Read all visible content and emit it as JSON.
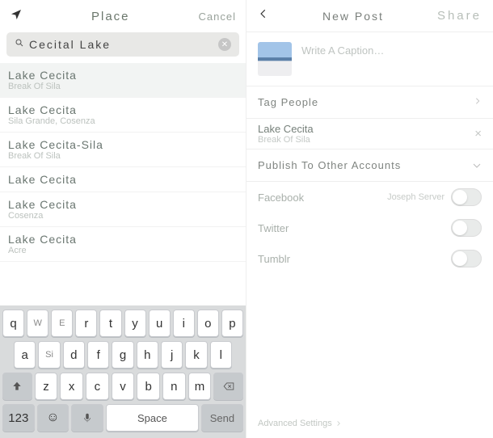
{
  "left": {
    "title": "Place",
    "cancel": "Cancel",
    "search": {
      "value": "Cecital Lake"
    },
    "places": [
      {
        "name": "Lake Cecita",
        "sub": "Break Of Sila",
        "selected": true
      },
      {
        "name": "Lake Cecita",
        "sub": "Sila Grande, Cosenza"
      },
      {
        "name": "Lake Cecita-Sila",
        "sub": "Break Of Sila"
      },
      {
        "name": "Lake Cecita",
        "sub": ""
      },
      {
        "name": "Lake Cecita",
        "sub": "Cosenza"
      },
      {
        "name": "Lake Cecita",
        "sub": "Acre"
      }
    ],
    "kbd": {
      "row1": [
        "q",
        "W",
        "E",
        "r",
        "t",
        "y",
        "u",
        "i",
        "o",
        "p"
      ],
      "row2": [
        "a",
        "Si",
        "d",
        "f",
        "g",
        "h",
        "j",
        "k",
        "l"
      ],
      "row3": [
        "z",
        "x",
        "c",
        "v",
        "b",
        "n",
        "m"
      ],
      "mode": "123",
      "space": "Space",
      "send": "Send"
    }
  },
  "right": {
    "title": "New Post",
    "share": "Share",
    "caption_placeholder": "Write A Caption…",
    "tag_people": "Tag People",
    "location": {
      "name": "Lake Cecita",
      "sub": "Break Of Sila"
    },
    "publish_label": "Publish To Other Accounts",
    "accounts": [
      {
        "name": "Facebook",
        "user": "Joseph Server"
      },
      {
        "name": "Twitter"
      },
      {
        "name": "Tumblr"
      }
    ],
    "advanced": "Advanced Settings"
  }
}
